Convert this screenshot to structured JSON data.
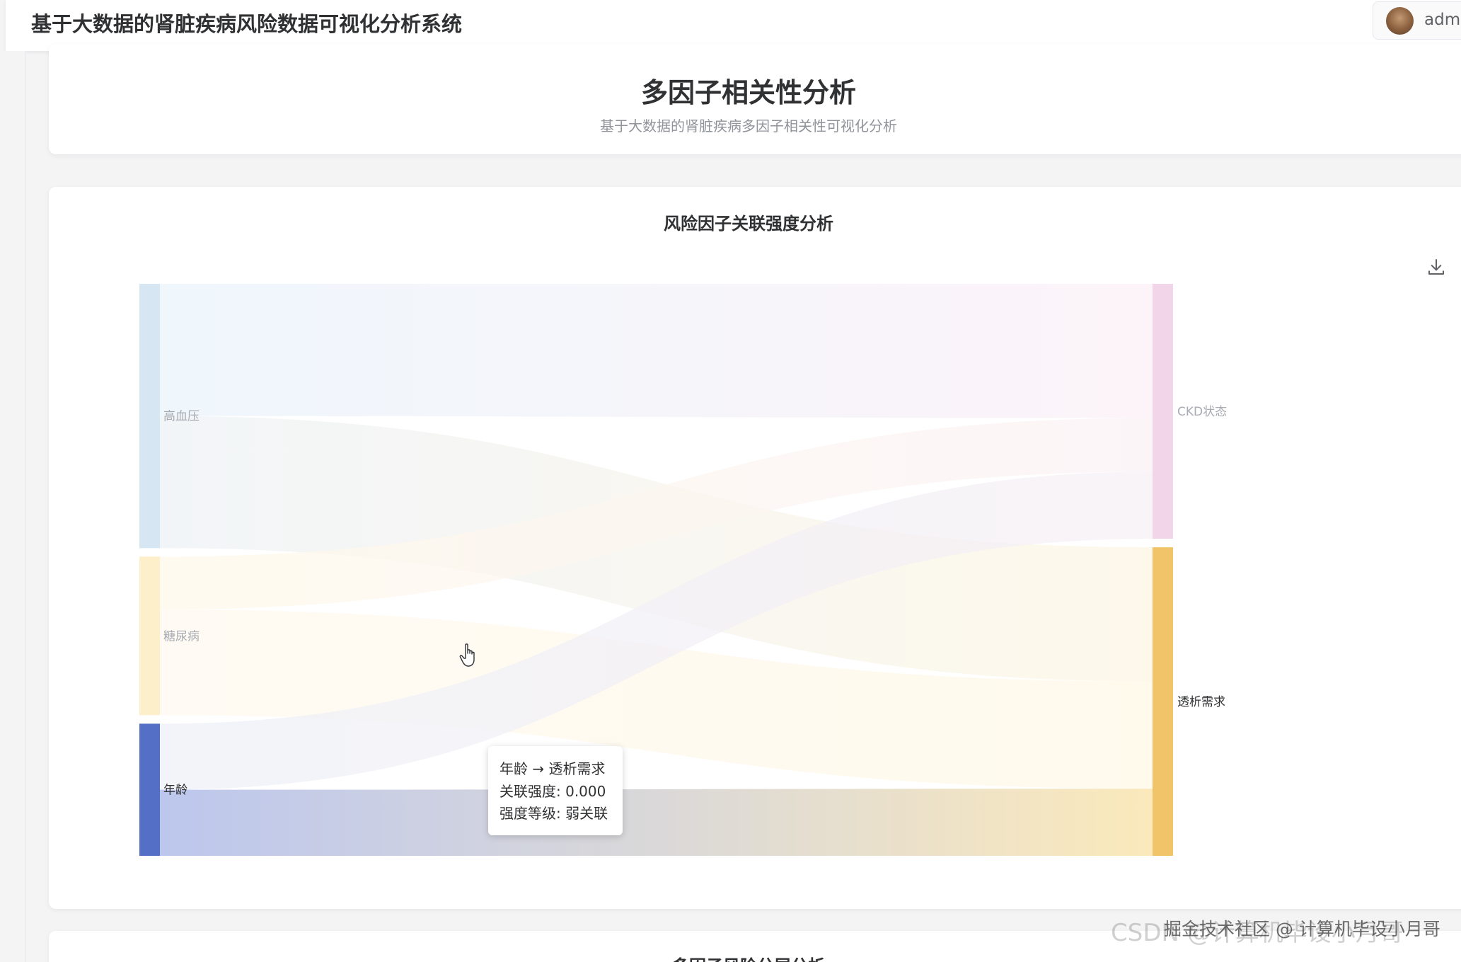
{
  "header": {
    "app_title": "基于大数据的肾脏疾病风险数据可视化分析系统",
    "username": "admin"
  },
  "hero": {
    "title": "多因子相关性分析",
    "subtitle": "基于大数据的肾脏疾病多因子相关性可视化分析"
  },
  "chart_card": {
    "title": "风险因子关联强度分析",
    "download_icon": "download-icon"
  },
  "next_card": {
    "title": "多因子风险分层分析"
  },
  "chart_data": {
    "type": "sankey",
    "title": "风险因子关联强度分析",
    "nodes": [
      {
        "name": "高血压",
        "side": "left",
        "color": "#d6e7f3"
      },
      {
        "name": "糖尿病",
        "side": "left",
        "color": "#fcefc9"
      },
      {
        "name": "年龄",
        "side": "left",
        "color": "#5470c6"
      },
      {
        "name": "CKD状态",
        "side": "right",
        "color": "#f3d5ea"
      },
      {
        "name": "透析需求",
        "side": "right",
        "color": "#f2c46a"
      }
    ],
    "links": [
      {
        "source": "高血压",
        "target": "CKD状态",
        "value": 0.5
      },
      {
        "source": "高血压",
        "target": "透析需求",
        "value": 0.5
      },
      {
        "source": "糖尿病",
        "target": "CKD状态",
        "value": 0.2
      },
      {
        "source": "糖尿病",
        "target": "透析需求",
        "value": 0.4
      },
      {
        "source": "年龄",
        "target": "CKD状态",
        "value": 0.25
      },
      {
        "source": "年龄",
        "target": "透析需求",
        "value": 0.25
      }
    ],
    "highlighted_node": "年龄"
  },
  "tooltip": {
    "line1": "年龄 → 透析需求",
    "line2": "关联强度: 0.000",
    "line3": "强度等级: 弱关联"
  },
  "watermark": {
    "text": "掘金技术社区 @ 计算机毕设小月哥",
    "faint": "CSDN @计算机毕设小月哥"
  }
}
